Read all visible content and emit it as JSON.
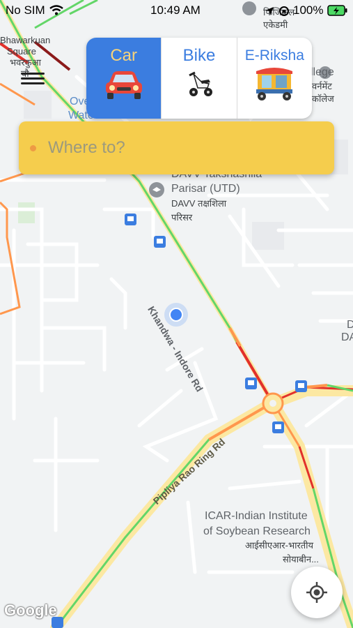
{
  "status_bar": {
    "carrier": "No SIM",
    "time": "10:49 AM",
    "battery": "100%"
  },
  "vehicles": [
    {
      "label": "Car",
      "icon": "car-icon",
      "selected": true
    },
    {
      "label": "Bike",
      "icon": "scooter-icon",
      "selected": false
    },
    {
      "label": "E-Riksha",
      "icon": "auto-rickshaw-icon",
      "selected": false
    }
  ],
  "search": {
    "placeholder": "Where to?"
  },
  "map": {
    "labels": {
      "bhawarkuan_1": "Bhawarkuan",
      "bhawarkuan_2": "Square",
      "bhawarkuan_hi": "भवरकुआ",
      "bhawarkuan_hi2": "चौ",
      "overhead_1": "Ove",
      "overhead_2": "Water Tank",
      "physical_1": "फिजिकल",
      "physical_2": "एकेडमी",
      "college_1": "llege",
      "college_2": "वर्नमेंट",
      "college_3": "कॉलेज",
      "davv_1": "DAVV Takshashila",
      "davv_2": "Parisar (UTD)",
      "davv_3": "DAVV तक्षशिला",
      "davv_4": "परिसर",
      "khandwa": "Khandwa - Indore Rd",
      "pipliya": "Pipliya Rao Ring Rd",
      "icar_1": "ICAR-Indian Institute",
      "icar_2": "of Soybean Research",
      "icar_3": "आईसीएआर-भारतीय",
      "icar_4": "सोयाबीन...",
      "edge_d": "D",
      "edge_da": "DA"
    },
    "attribution": "Google"
  },
  "colors": {
    "accent_blue": "#3b7de0",
    "search_yellow": "#f5cd4d",
    "traffic_green": "#63d668",
    "traffic_orange": "#ff974d",
    "traffic_red": "#e2312b",
    "road_yellow": "#fce8a2"
  }
}
